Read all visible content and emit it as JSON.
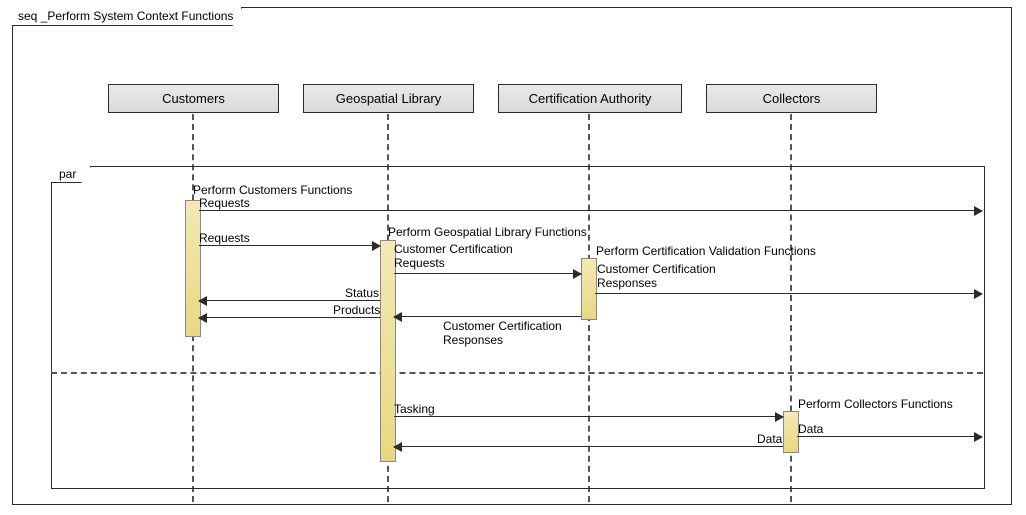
{
  "frame": {
    "title": "seq _Perform System Context Functions",
    "operator": "seq"
  },
  "lifelines": [
    {
      "name": "Customers"
    },
    {
      "name": "Geospatial Library"
    },
    {
      "name": "Certification Authority"
    },
    {
      "name": "Collectors"
    }
  ],
  "parFrame": {
    "operator": "par"
  },
  "activationLabels": {
    "customers": "Perform Customers Functions",
    "geolib": "Perform Geospatial Library Functions",
    "certauth": "Perform Certification Validation Functions",
    "collectors": "Perform Collectors Functions"
  },
  "messages": {
    "requests_out": "Requests",
    "requests_in": "Requests",
    "custCertReq": "Customer Certification\nRequests",
    "custCertRespRight": "Customer Certification\nResponses",
    "status": "Status",
    "products": "Products",
    "custCertRespLeft": "Customer Certification\nResponses",
    "tasking": "Tasking",
    "data_left": "Data",
    "data_right": "Data"
  }
}
